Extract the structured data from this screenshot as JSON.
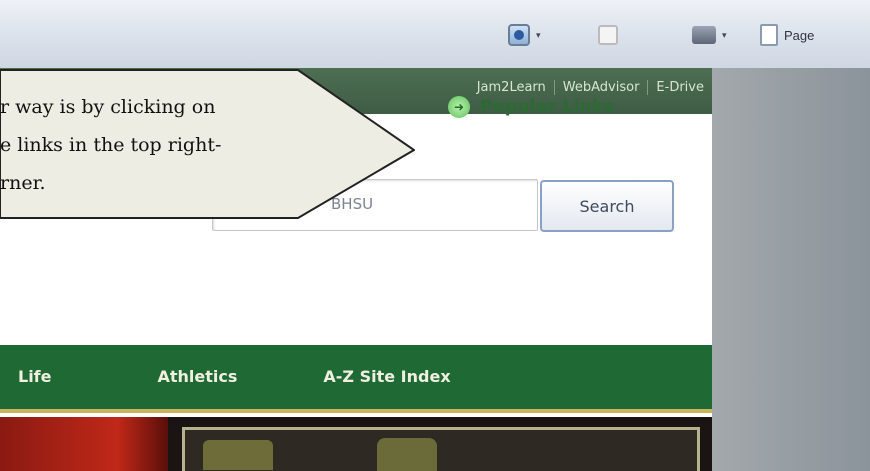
{
  "toolbar": {
    "page_label": "Page",
    "dropdown_glyph": "▾"
  },
  "utility_links": [
    "Jam2Learn",
    "WebAdvisor",
    "E-Drive"
  ],
  "popular_links": {
    "label": "Popular Links",
    "icon": "arrow-circle-icon"
  },
  "search": {
    "placeholder": "BHSU",
    "button_label": "Search"
  },
  "main_nav": [
    "Life",
    "Athletics",
    "A-Z Site Index"
  ],
  "callout": {
    "lines": [
      "r way is by clicking on",
      "e links in the top right-",
      "rner."
    ]
  },
  "colors": {
    "nav_green": "#1f6a34",
    "utility_green": "#4e6f52",
    "popular_green": "#2b6a32",
    "callout_fill": "#eeede4"
  }
}
